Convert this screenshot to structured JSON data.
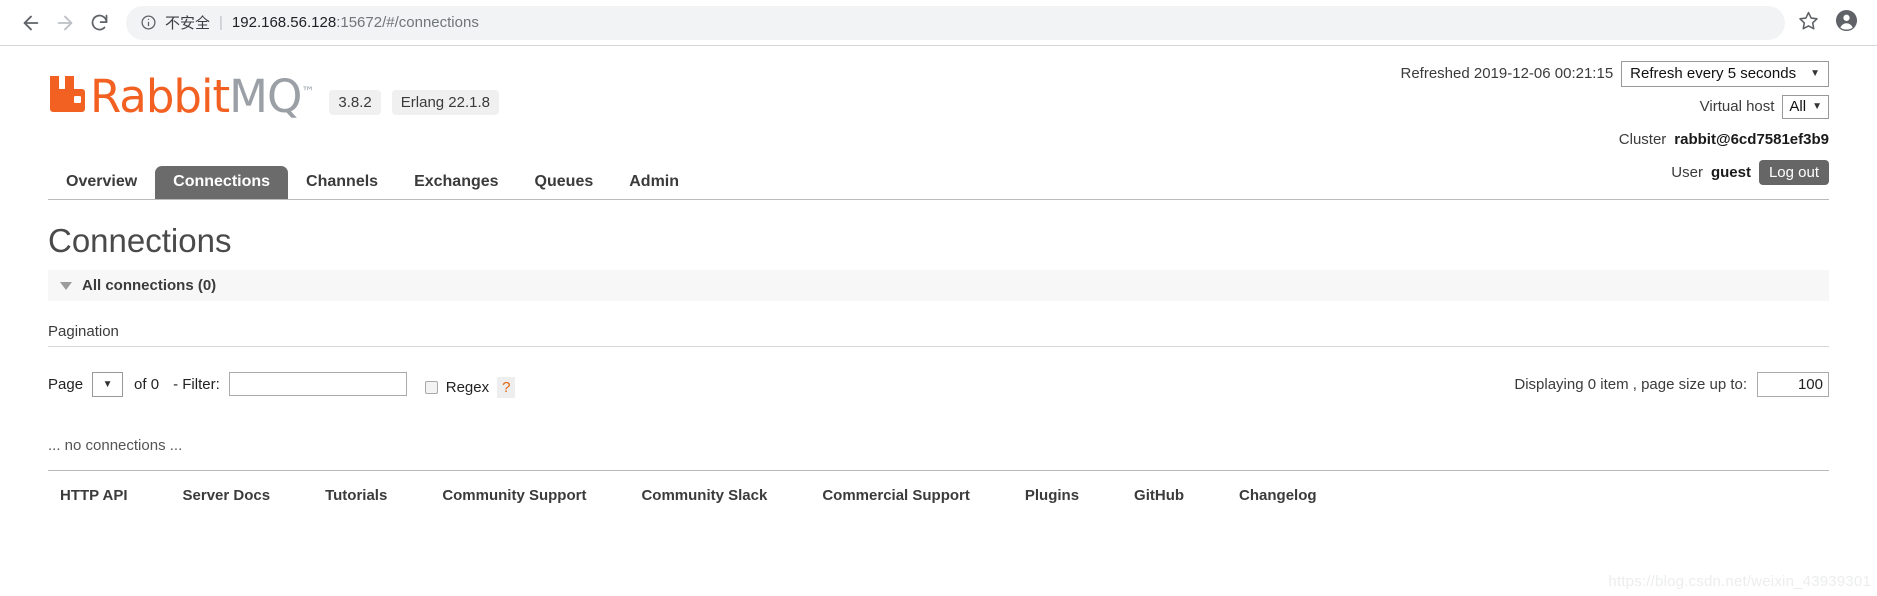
{
  "browser": {
    "back_icon": "arrow-left-icon",
    "forward_icon": "arrow-right-icon",
    "reload_icon": "reload-icon",
    "info_icon": "info-circle-icon",
    "security_label": "不安全",
    "separator": "|",
    "url_host": "192.168.56.128",
    "url_path": ":15672/#/connections",
    "bookmark_icon": "star-icon",
    "profile_icon": "account-avatar-icon"
  },
  "header": {
    "logo_rabbit": "Rabbit",
    "logo_mq": "MQ",
    "logo_tm": "™",
    "version_server": "3.8.2",
    "version_erlang": "Erlang 22.1.8",
    "refreshed_label": "Refreshed 2019-12-06 00:21:15",
    "refresh_select": "Refresh every 5 seconds",
    "vhost_label": "Virtual host",
    "vhost_select": "All",
    "cluster_label": "Cluster",
    "cluster_name": "rabbit@6cd7581ef3b9",
    "user_label": "User",
    "user_name": "guest",
    "logout_label": "Log out"
  },
  "tabs": [
    {
      "label": "Overview",
      "active": false
    },
    {
      "label": "Connections",
      "active": true
    },
    {
      "label": "Channels",
      "active": false
    },
    {
      "label": "Exchanges",
      "active": false
    },
    {
      "label": "Queues",
      "active": false
    },
    {
      "label": "Admin",
      "active": false
    }
  ],
  "main": {
    "page_title": "Connections",
    "section_title": "All connections (0)",
    "pagination_label": "Pagination",
    "page_label": "Page",
    "page_value": "",
    "of_label": "of 0",
    "filter_label": "- Filter:",
    "filter_value": "",
    "regex_label": "Regex",
    "help_label": "?",
    "displaying_label": "Displaying 0 item , page size up to:",
    "page_size_value": "100",
    "empty_message": "... no connections ..."
  },
  "footer": {
    "links": [
      "HTTP API",
      "Server Docs",
      "Tutorials",
      "Community Support",
      "Community Slack",
      "Commercial Support",
      "Plugins",
      "GitHub",
      "Changelog"
    ]
  },
  "watermark": "https://blog.csdn.net/weixin_43939301",
  "colors": {
    "brand_orange": "#f26122",
    "tab_active_bg": "#6b6b6b",
    "logout_bg": "#666666",
    "help_orange": "#e2640d"
  }
}
